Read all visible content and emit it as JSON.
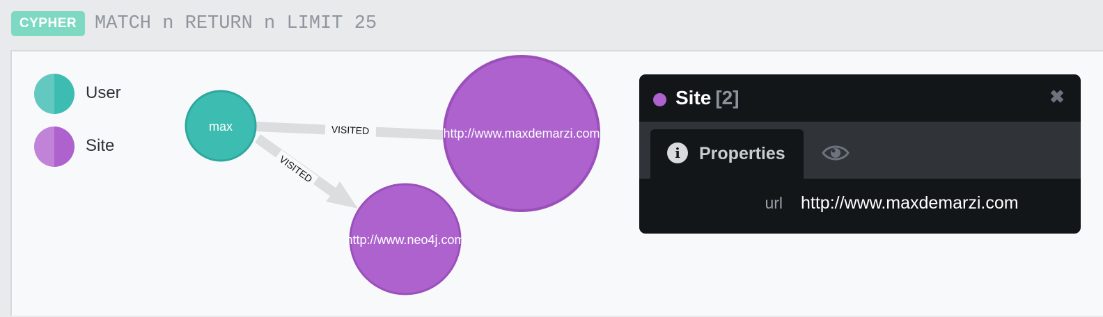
{
  "query": {
    "badge": "CYPHER",
    "text": "MATCH n RETURN n LIMIT 25"
  },
  "legend": [
    {
      "label": "User",
      "color": "#3dbdb2",
      "color_light": "#63c8bf"
    },
    {
      "label": "Site",
      "color": "#ad62ce",
      "color_light": "#c083d8"
    }
  ],
  "graph": {
    "nodes": [
      {
        "id": "max",
        "label": "max",
        "type": "User"
      },
      {
        "id": "maxdemarzi",
        "label": "http://www.maxdemarzi.com",
        "type": "Site"
      },
      {
        "id": "neo4j",
        "label": "http://www.neo4j.com",
        "type": "Site"
      }
    ],
    "relationships": [
      {
        "from": "max",
        "to": "maxdemarzi",
        "label": "VISITED"
      },
      {
        "from": "max",
        "to": "neo4j",
        "label": "VISITED"
      }
    ]
  },
  "inspector": {
    "dot_color": "#ad62ce",
    "title": "Site",
    "count": "[2]",
    "close_icon": "close-icon",
    "tabs": [
      {
        "label": "Properties",
        "icon": "info-icon",
        "active": true
      },
      {
        "label": "",
        "icon": "eye-icon",
        "active": false
      }
    ],
    "properties": [
      {
        "key": "url",
        "value": "http://www.maxdemarzi.com"
      }
    ]
  },
  "colors": {
    "user_node": "#3dbdb2",
    "site_node": "#ad62ce",
    "relationship": "#dcdddf"
  }
}
